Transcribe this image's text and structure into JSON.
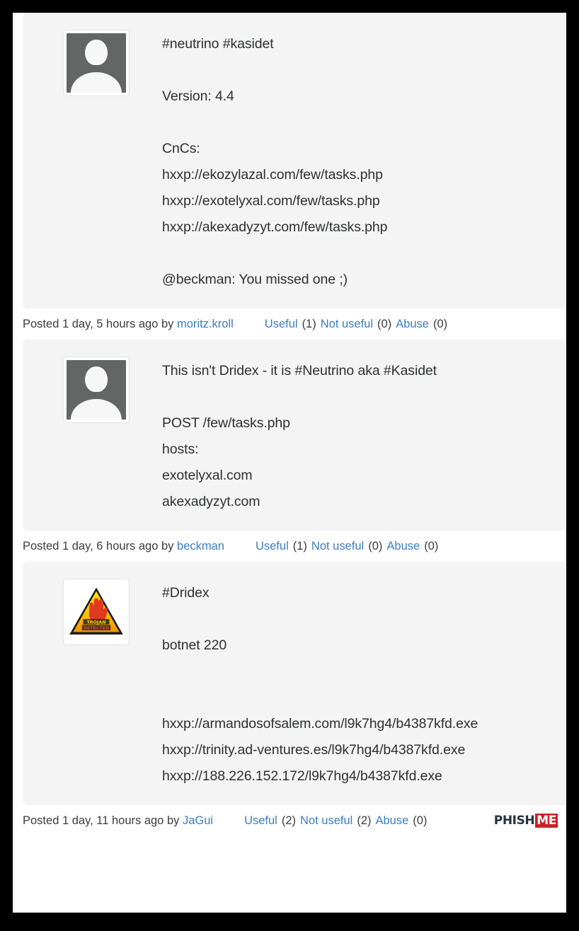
{
  "page": {
    "title": "Threat intelligence thread"
  },
  "colors": {
    "link": "#3b7ec4",
    "text": "#2f3031",
    "panel": "#f4f4f4",
    "page_background": "#ffffff",
    "frame": "#000000",
    "logo_dark": "#25333f",
    "logo_red": "#cf2027"
  },
  "labels": {
    "useful": "Useful",
    "not_useful": "Not useful",
    "abuse": "Abuse"
  },
  "branding": {
    "logo_part1": "PHISH",
    "logo_part2": "ME"
  },
  "posts": [
    {
      "id": "post-1",
      "avatar_type": "default-user-avatar",
      "body": "#neutrino #kasidet\n\nVersion: 4.4\n\nCnCs:\nhxxp://ekozylazal.com/few/tasks.php\nhxxp://exotelyxal.com/few/tasks.php\nhxxp://akexadyzyt.com/few/tasks.php\n\n@beckman: You missed one ;)",
      "posted": "Posted 1 day, 5 hours ago by",
      "author": "moritz.kroll",
      "useful_count": "(1)",
      "not_useful_count": "(0)",
      "abuse_count": "(0)",
      "show_logo": false
    },
    {
      "id": "post-2",
      "avatar_type": "default-user-avatar",
      "body": "This isn't Dridex - it is #Neutrino aka #Kasidet\n\nPOST /few/tasks.php\nhosts:\nexotelyxal.com\nakexadyzyt.com",
      "posted": "Posted 1 day, 6 hours ago by",
      "author": "beckman",
      "useful_count": "(1)",
      "not_useful_count": "(0)",
      "abuse_count": "(0)",
      "show_logo": false
    },
    {
      "id": "post-3",
      "avatar_type": "trojan-detected-avatar",
      "body": "#Dridex\n\nbotnet 220\n\n\nhxxp://armandosofsalem.com/l9k7hg4/b4387kfd.exe\nhxxp://trinity.ad-ventures.es/l9k7hg4/b4387kfd.exe\nhxxp://188.226.152.172/l9k7hg4/b4387kfd.exe",
      "posted": "Posted 1 day, 11 hours ago by",
      "author": "JaGui",
      "useful_count": "(2)",
      "not_useful_count": "(2)",
      "abuse_count": "(0)",
      "show_logo": true
    }
  ]
}
